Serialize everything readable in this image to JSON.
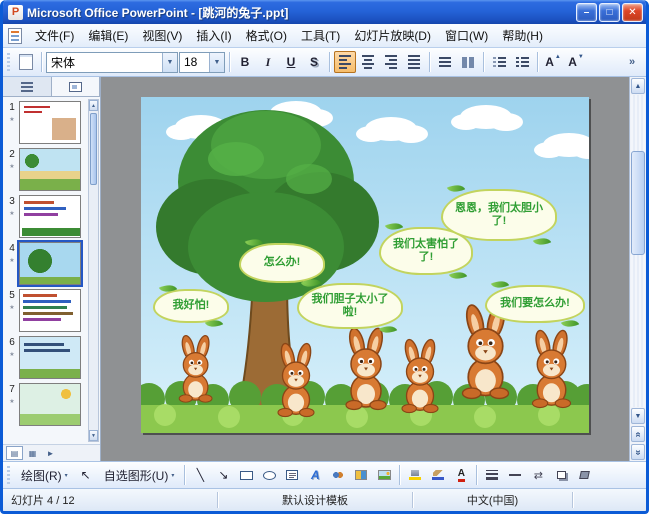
{
  "window": {
    "title": "Microsoft Office PowerPoint - [跳河的兔子.ppt]"
  },
  "icons": {
    "app": "P",
    "minimize": "–",
    "maximize": "□",
    "close": "✕",
    "dropdown": "▼",
    "dropdown_small": "▾",
    "overflow": "»",
    "scroll_up": "▲",
    "scroll_down": "▼",
    "prev_slide": "«",
    "next_slide": "»",
    "animation_star": "★",
    "view_normal": "▤",
    "view_sorter": "▦",
    "view_show": "►",
    "select_tool": "↖",
    "line_tool": "╲",
    "arrow_tool": "↘",
    "wordart": "A",
    "font_color": "A",
    "grow_font": "A",
    "shrink_font": "A",
    "arrow_style": "⇄"
  },
  "menu": {
    "items": [
      "文件(F)",
      "编辑(E)",
      "视图(V)",
      "插入(I)",
      "格式(O)",
      "工具(T)",
      "幻灯片放映(D)",
      "窗口(W)",
      "帮助(H)"
    ]
  },
  "toolbar": {
    "font_name": "宋体",
    "font_size": "18",
    "bold": "B",
    "italic": "I",
    "underline": "U",
    "shadow": "S"
  },
  "slides_panel": {
    "slides": [
      {
        "number": "1"
      },
      {
        "number": "2"
      },
      {
        "number": "3"
      },
      {
        "number": "4"
      },
      {
        "number": "5"
      },
      {
        "number": "6"
      },
      {
        "number": "7"
      }
    ]
  },
  "slide": {
    "bubbles": [
      {
        "text": "我好怕!"
      },
      {
        "text": "怎么办!"
      },
      {
        "text": "我们胆子太小了啦!"
      },
      {
        "text": "我们太害怕了了!"
      },
      {
        "text": "恩恩，我们太胆小了!"
      },
      {
        "text": "我们要怎么办!"
      }
    ]
  },
  "drawing_toolbar": {
    "draw_label": "绘图(R)",
    "autoshapes_label": "自选图形(U)"
  },
  "status_bar": {
    "slide_indicator": "幻灯片 4 / 12",
    "design_template": "默认设计模板",
    "language": "中文(中国)"
  }
}
